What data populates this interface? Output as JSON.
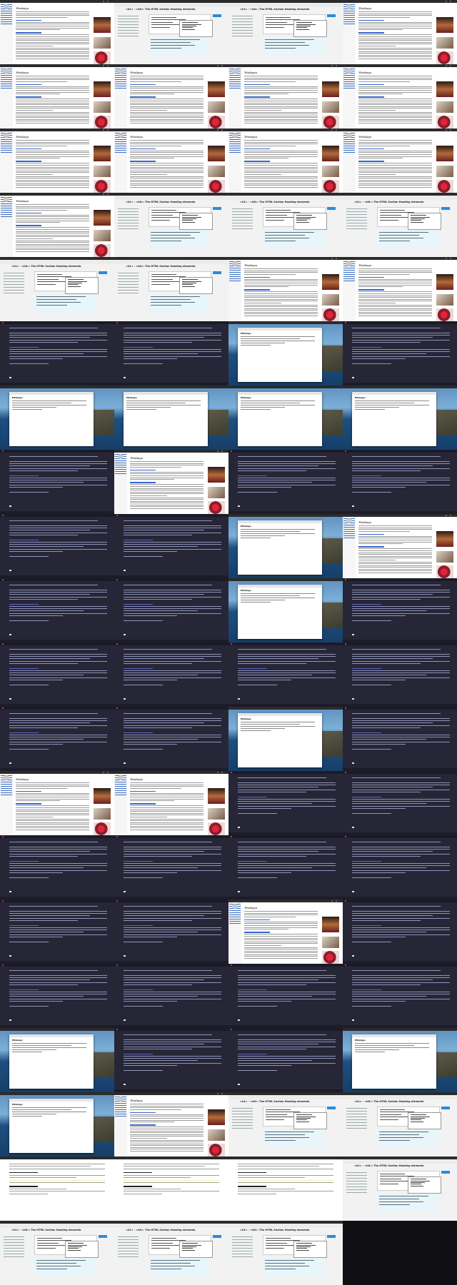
{
  "wiki_title": "Pitahaya",
  "tutorial_title": "<h1> - <h6>: The HTML Section Heading elements",
  "notes_heading": "Pitahaya",
  "tiles": [
    {
      "kind": "wiki"
    },
    {
      "kind": "tut"
    },
    {
      "kind": "tut"
    },
    {
      "kind": "wiki"
    },
    {
      "kind": "wiki"
    },
    {
      "kind": "wiki"
    },
    {
      "kind": "wiki"
    },
    {
      "kind": "wiki"
    },
    {
      "kind": "wiki"
    },
    {
      "kind": "wiki"
    },
    {
      "kind": "wiki"
    },
    {
      "kind": "wiki"
    },
    {
      "kind": "wiki"
    },
    {
      "kind": "tut"
    },
    {
      "kind": "tut"
    },
    {
      "kind": "tut"
    },
    {
      "kind": "tut"
    },
    {
      "kind": "tut"
    },
    {
      "kind": "wiki"
    },
    {
      "kind": "wiki"
    },
    {
      "kind": "term"
    },
    {
      "kind": "term"
    },
    {
      "kind": "desk"
    },
    {
      "kind": "term"
    },
    {
      "kind": "desk"
    },
    {
      "kind": "desk"
    },
    {
      "kind": "desk"
    },
    {
      "kind": "desk"
    },
    {
      "kind": "term"
    },
    {
      "kind": "wiki"
    },
    {
      "kind": "term"
    },
    {
      "kind": "term"
    },
    {
      "kind": "term"
    },
    {
      "kind": "term"
    },
    {
      "kind": "desk"
    },
    {
      "kind": "wiki"
    },
    {
      "kind": "term"
    },
    {
      "kind": "term"
    },
    {
      "kind": "desk"
    },
    {
      "kind": "term"
    },
    {
      "kind": "term"
    },
    {
      "kind": "term"
    },
    {
      "kind": "term"
    },
    {
      "kind": "term"
    },
    {
      "kind": "term"
    },
    {
      "kind": "term"
    },
    {
      "kind": "desk"
    },
    {
      "kind": "term"
    },
    {
      "kind": "wiki"
    },
    {
      "kind": "wiki"
    },
    {
      "kind": "term"
    },
    {
      "kind": "term"
    },
    {
      "kind": "term"
    },
    {
      "kind": "term"
    },
    {
      "kind": "term"
    },
    {
      "kind": "term"
    },
    {
      "kind": "term"
    },
    {
      "kind": "term"
    },
    {
      "kind": "wiki"
    },
    {
      "kind": "term"
    },
    {
      "kind": "term"
    },
    {
      "kind": "term"
    },
    {
      "kind": "term"
    },
    {
      "kind": "term"
    },
    {
      "kind": "desk"
    },
    {
      "kind": "term"
    },
    {
      "kind": "term"
    },
    {
      "kind": "desk"
    },
    {
      "kind": "desk"
    },
    {
      "kind": "wiki"
    },
    {
      "kind": "tut"
    },
    {
      "kind": "tut"
    },
    {
      "kind": "doc"
    },
    {
      "kind": "doc"
    },
    {
      "kind": "doc"
    },
    {
      "kind": "tut"
    },
    {
      "kind": "tut"
    },
    {
      "kind": "tut"
    },
    {
      "kind": "tut"
    },
    {
      "kind": "empty"
    }
  ]
}
